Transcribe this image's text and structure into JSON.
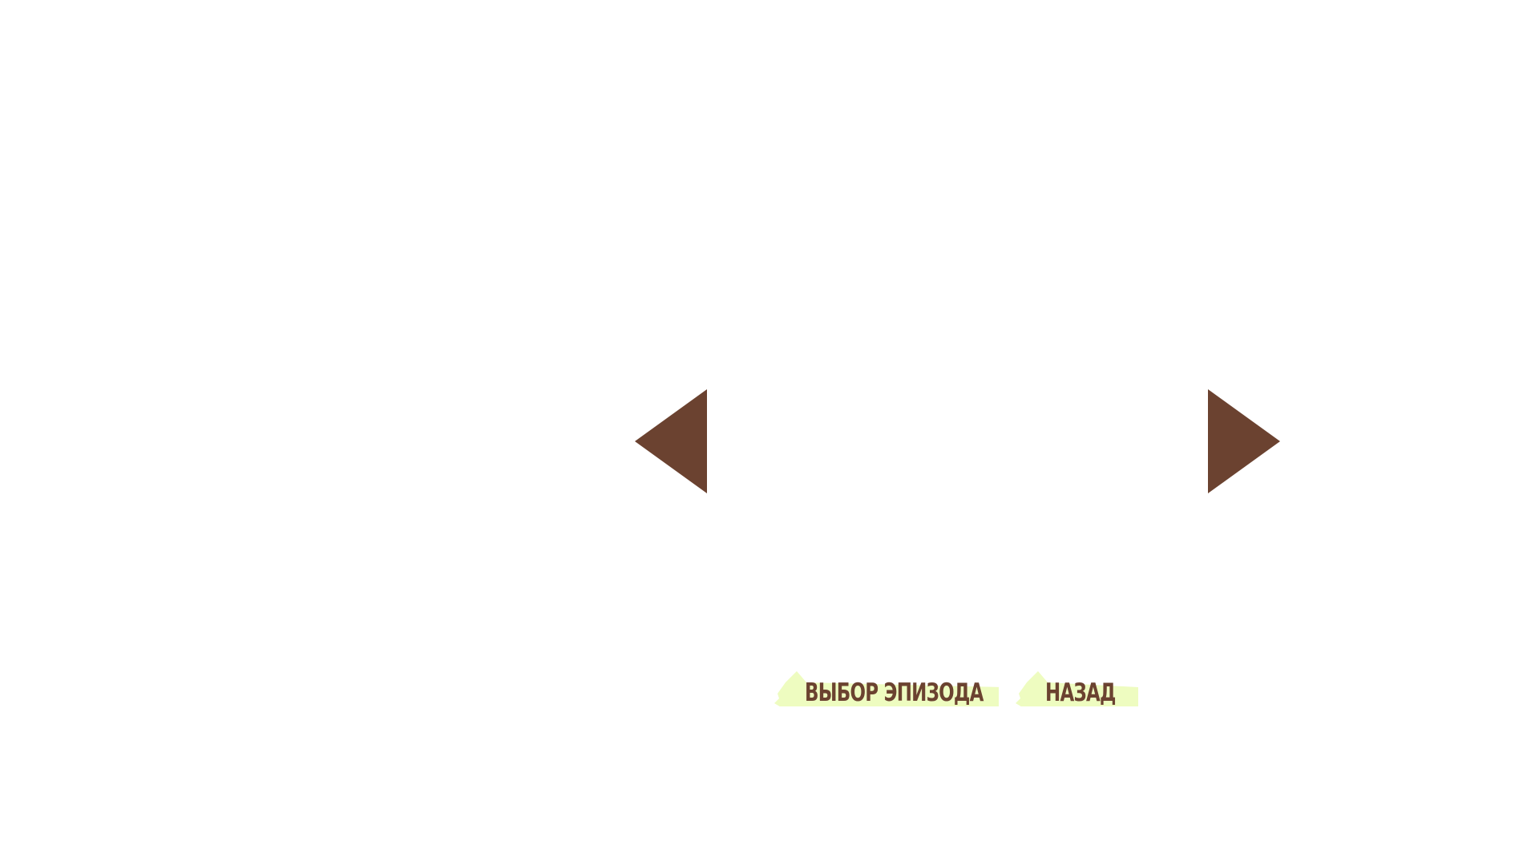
{
  "colors": {
    "background": "#ffffff",
    "accent": "#6b4230",
    "button_bg": "#eefcc0"
  },
  "navigation": {
    "prev_icon": "triangle-left-icon",
    "next_icon": "triangle-right-icon"
  },
  "menu": {
    "episode_select_label": "ВЫБОР ЭПИЗОДА",
    "back_label": "НАЗАД"
  }
}
